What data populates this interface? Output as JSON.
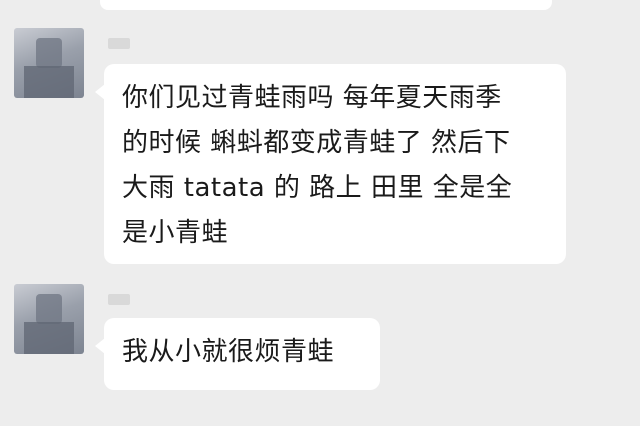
{
  "chat": {
    "messages": [
      {
        "text": "你们见过青蛙雨吗 每年夏天雨季\n的时候 蝌蚪都变成青蛙了 然后下\n大雨 tatata 的 路上 田里 全是全\n是小青蛙"
      },
      {
        "text": "我从小就很烦青蛙"
      }
    ]
  }
}
